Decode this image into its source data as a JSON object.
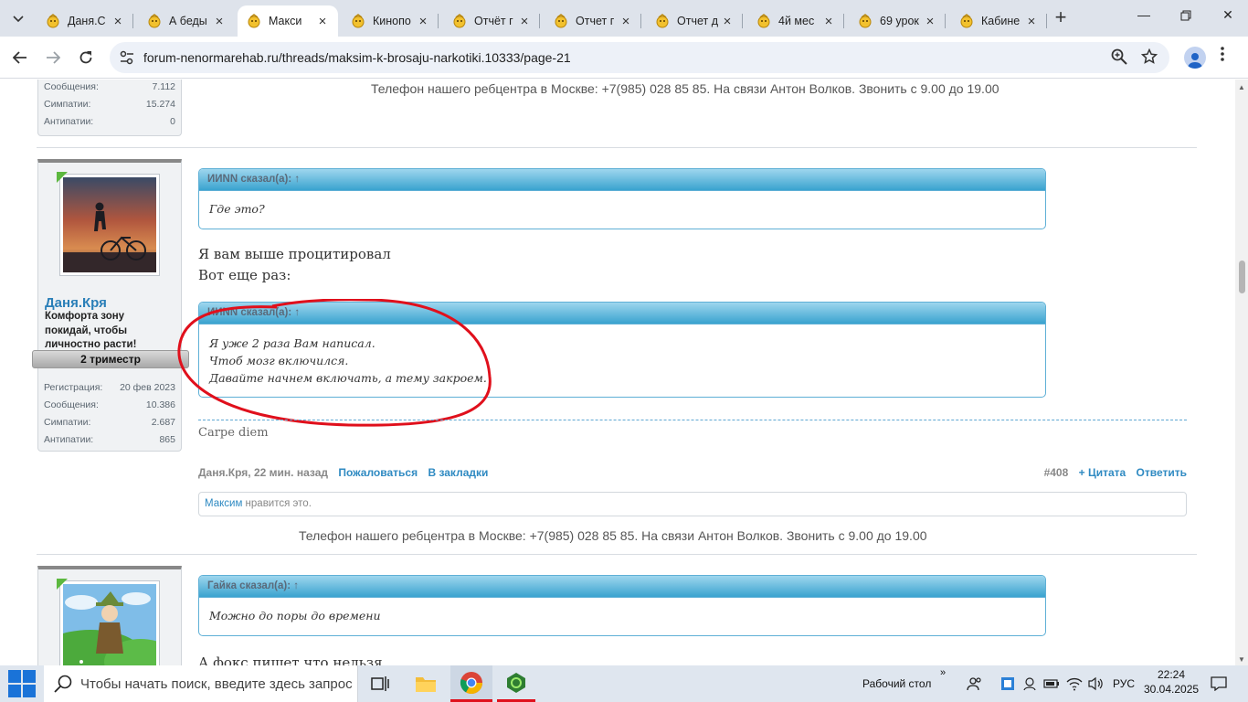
{
  "browser": {
    "tabs": [
      {
        "title": "Даня.С",
        "active": false
      },
      {
        "title": "А беды",
        "active": false
      },
      {
        "title": "Макси",
        "active": true
      },
      {
        "title": "Кинопо",
        "active": false
      },
      {
        "title": "Отчёт г",
        "active": false
      },
      {
        "title": "Отчет г",
        "active": false
      },
      {
        "title": "Отчет д",
        "active": false
      },
      {
        "title": "4й мес",
        "active": false
      },
      {
        "title": "69 урок",
        "active": false
      },
      {
        "title": "Кабине",
        "active": false
      }
    ],
    "url": "forum-nenormarehab.ru/threads/maksim-k-brosaju-narkotiki.10333/page-21"
  },
  "posts": {
    "prev": {
      "stats": [
        {
          "label": "Сообщения:",
          "value": "7.112"
        },
        {
          "label": "Симпатии:",
          "value": "15.274"
        },
        {
          "label": "Антипатии:",
          "value": "0"
        }
      ],
      "phone_text": "Телефон нашего ребцентра в Москве: +7(985) 028 85 85. На связи Антон Волков. Звонить с 9.00 до 19.00"
    },
    "main": {
      "username": "Даня.Кря",
      "user_title": "Комфорта зону покидай, чтобы личностно расти!",
      "ribbon": "2 триместр",
      "stats": [
        {
          "label": "Регистрация:",
          "value": "20 фев 2023"
        },
        {
          "label": "Сообщения:",
          "value": "10.386"
        },
        {
          "label": "Симпатии:",
          "value": "2.687"
        },
        {
          "label": "Антипатии:",
          "value": "865"
        }
      ],
      "quote1": {
        "head": "ИИNN сказал(а): ↑",
        "body": "Где это?"
      },
      "message_lines": [
        "Я вам выше процитировал",
        "Вот еще раз:"
      ],
      "quote2": {
        "head": "ИИNN сказал(а): ↑",
        "lines": [
          "Я уже 2 раза Вам написал.",
          "Чтоб мозг включился.",
          "Давайте начнем включать, а тему закроем."
        ]
      },
      "signature": "Carpe diem",
      "meta_author_time": "Даня.Кря, 22 мин. назад",
      "report": "Пожаловаться",
      "bookmark": "В закладки",
      "post_number": "#408",
      "quote_action": "+ Цитата",
      "reply_action": "Ответить",
      "likes_user": "Максим",
      "likes_text": " нравится это.",
      "phone_text": "Телефон нашего ребцентра в Москве: +7(985) 028 85 85. На связи Антон Волков. Звонить с 9.00 до 19.00"
    },
    "next": {
      "quote1": {
        "head": "Гайка сказал(а): ↑",
        "body": "Можно до поры до времени"
      },
      "message_partial": "А фокс пишет что нельзя"
    }
  },
  "taskbar": {
    "search_placeholder": "Чтобы начать поиск, введите здесь запрос",
    "desktop_label": "Рабочий стол",
    "lang": "РУС",
    "time": "22:24",
    "date": "30.04.2025"
  },
  "colors": {
    "link": "#2f8ac2",
    "quote_header": "#3aa3cf",
    "annotation_circle": "#e0101c",
    "online_badge": "#5cb83f"
  }
}
